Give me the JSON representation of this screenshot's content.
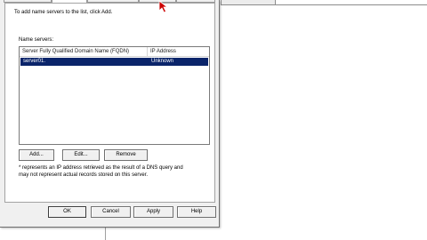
{
  "dialog": {
    "intro": "To add name servers to the list, click Add.",
    "list_label": "Name servers:",
    "columns": [
      "Server Fully Qualified Domain Name (FQDN)",
      "IP Address"
    ],
    "rows": [
      {
        "fqdn": "server01.",
        "ip": "Unknown",
        "selected": true
      }
    ],
    "buttons": {
      "add": "Add...",
      "edit": "Edit...",
      "remove": "Remove"
    },
    "note_lines": [
      "* represents an IP address retrieved as the result of a DNS query and",
      "may not represent actual records stored on this server."
    ],
    "footer": {
      "ok": "OK",
      "cancel": "Cancel",
      "apply": "Apply",
      "help": "Help"
    }
  },
  "colors": {
    "selection": "#0a246a",
    "dialog_bg": "#f0f0f0",
    "cursor": "#cc0000"
  },
  "icons": {
    "cursor": "mouse-pointer-icon"
  }
}
